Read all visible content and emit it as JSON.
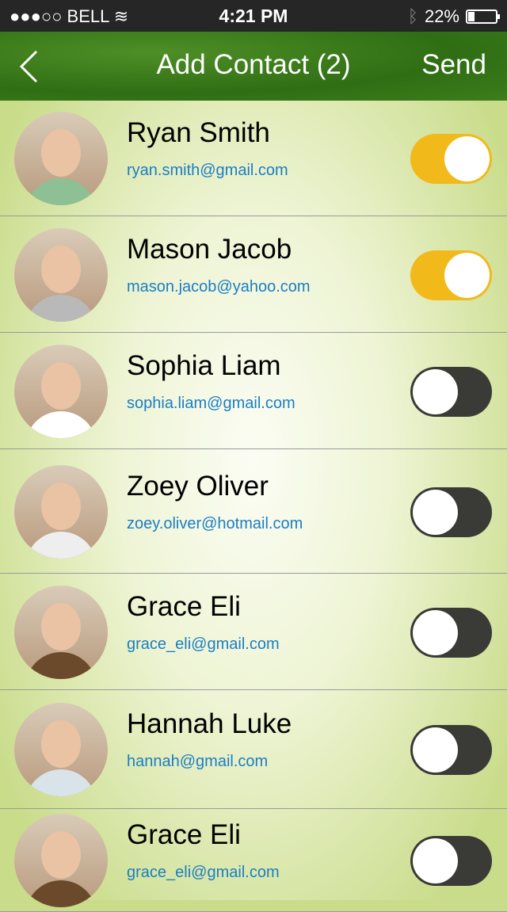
{
  "status_bar": {
    "carrier": "●●●○○ BELL",
    "time": "4:21 PM",
    "battery": "22%",
    "battery_level": 0.22
  },
  "nav": {
    "title": "Add Contact (2)",
    "send_label": "Send"
  },
  "contacts": [
    {
      "name": "Ryan Smith",
      "email": "ryan.smith@gmail.com",
      "selected": true
    },
    {
      "name": "Mason Jacob",
      "email": "mason.jacob@yahoo.com",
      "selected": true
    },
    {
      "name": "Sophia Liam",
      "email": "sophia.liam@gmail.com",
      "selected": false
    },
    {
      "name": "Zoey Oliver",
      "email": "zoey.oliver@hotmail.com",
      "selected": false
    },
    {
      "name": "Grace Eli",
      "email": "grace_eli@gmail.com",
      "selected": false
    },
    {
      "name": "Hannah Luke",
      "email": "hannah@gmail.com",
      "selected": false
    },
    {
      "name": "Grace Eli",
      "email": "grace_eli@gmail.com",
      "selected": false
    }
  ],
  "colors": {
    "toggle_on": "#f2b91b",
    "toggle_off": "#3a3a36",
    "email": "#1a7ec4",
    "nav": "#3d7d1b"
  }
}
